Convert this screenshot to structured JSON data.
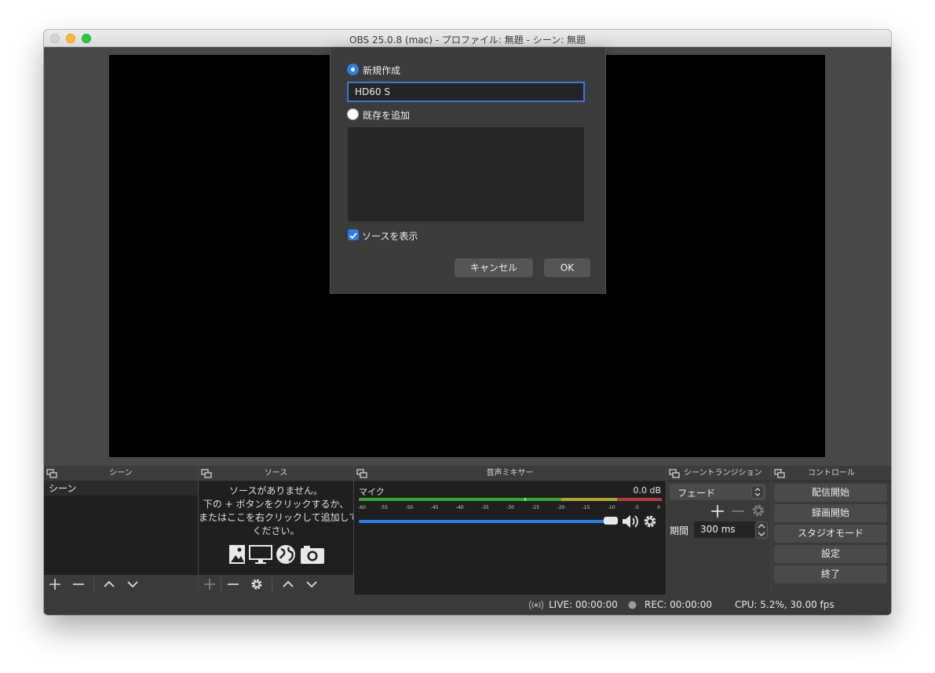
{
  "window": {
    "title": "OBS 25.0.8 (mac) - プロファイル: 無題 - シーン: 無題"
  },
  "docks": {
    "scenes": {
      "title": "シーン",
      "items": [
        "シーン"
      ]
    },
    "sources": {
      "title": "ソース",
      "empty_lines": [
        "ソースがありません。",
        "下の + ボタンをクリックするか、",
        "またはここを右クリックして追加して",
        "ください。"
      ]
    },
    "mixer": {
      "title": "音声ミキサー",
      "channel": "マイク",
      "level": "0.0 dB",
      "ticks": [
        "-60",
        "-55",
        "-50",
        "-45",
        "-40",
        "-35",
        "-30",
        "-25",
        "-20",
        "-15",
        "-10",
        "-5",
        "0"
      ],
      "volume": 0.98
    },
    "transitions": {
      "title": "シーントランジション",
      "selected": "フェード",
      "duration_label": "期間",
      "duration_value": "300 ms"
    },
    "controls": {
      "title": "コントロール",
      "buttons": [
        "配信開始",
        "録画開始",
        "スタジオモード",
        "設定",
        "終了"
      ]
    }
  },
  "status": {
    "live": "LIVE: 00:00:00",
    "rec": "REC: 00:00:00",
    "cpu": "CPU: 5.2%, 30.00 fps"
  },
  "dialog": {
    "create_new_label": "新規作成",
    "name_value": "HD60 S",
    "add_existing_label": "既存を追加",
    "visible_label": "ソースを表示",
    "cancel_label": "キャンセル",
    "ok_label": "OK"
  },
  "colors": {
    "accent": "#2b7de9",
    "panel_bg": "#3a3a3a",
    "preview_bg": "#000000"
  }
}
